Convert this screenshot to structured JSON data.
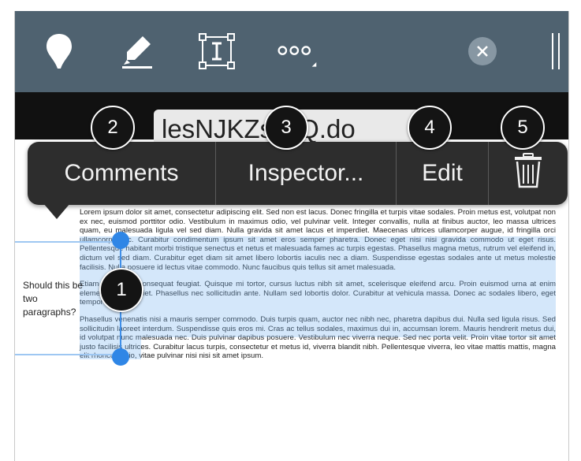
{
  "toolbar": {
    "icons": [
      "pin-icon",
      "highlighter-icon",
      "text-box-icon",
      "more-icon",
      "close-icon",
      "sidebar-handle-icon"
    ]
  },
  "document": {
    "filename_tab": "lesNJKZstNQ.do",
    "paragraphs": [
      "Lorem ipsum dolor sit amet, consectetur adipiscing elit. Sed non est lacus. Donec fringilla et turpis vitae sodales. Proin metus est, volutpat non ex nec, euismod porttitor odio. Vestibulum in maximus odio, vel pulvinar velit. Integer convallis, nulla at finibus auctor, leo massa ultrices quam, eu malesuada ligula vel sed diam. Nulla gravida sit amet lacus et imperdiet. Maecenas ultrices ullamcorper augue, id fringilla orci ullamcorper ac. Curabitur condimentum ipsum sit amet eros semper pharetra. Donec eget nisi nisi gravida commodo ut eget risus. Pellentesque habitant morbi tristique senectus et netus et malesuada fames ac turpis egestas. Phasellus magna metus, rutrum vel eleifend in, dictum vel sed diam. Curabitur eget diam sit amet libero lobortis iaculis nec a diam. Suspendisse egestas sodales ante ut metus molestie facilisis. Nulla posuere id lectus vitae commodo. Nunc faucibus quis tellus sit amet malesuada.",
      "Etiam bibendum consequat feugiat. Quisque mi tortor, cursus luctus nibh sit amet, scelerisque eleifend arcu. Proin euismod urna at enim elementum imperdiet. Phasellus nec sollicitudin ante. Nullam sed lobortis dolor. Curabitur at vehicula massa. Donec ac sodales libero, eget tempor sem.",
      "Phasellus venenatis nisi a mauris semper commodo. Duis turpis quam, auctor nec nibh nec, pharetra dapibus dui. Nulla sed ligula risus. Sed sollicitudin laoreet interdum. Suspendisse quis eros mi. Cras ac tellus sodales, maximus dui in, accumsan lorem. Mauris hendrerit metus dui, id volutpat nunc malesuada nec. Duis pulvinar dapibus posuere. Vestibulum nec viverra neque. Sed nec porta velit. Proin vitae tortor sit amet justo facilisis ultrices. Curabitur lacus turpis, consectetur et metus id, viverra blandit nibh. Pellentesque viverra, leo vitae mattis mattis, magna elit rhoncus odio, vitae pulvinar nisi nisi sit amet ipsum."
    ],
    "comment_note": "Should this be two paragraphs?"
  },
  "context_menu": {
    "comments_label": "Comments",
    "inspector_label": "Inspector...",
    "edit_label": "Edit",
    "delete_icon": "trash-icon"
  },
  "callouts": [
    "1",
    "2",
    "3",
    "4",
    "5"
  ],
  "colors": {
    "toolbar_bg": "#4f6270",
    "menu_bg": "#2d2d2d",
    "selection_handle": "#2f86e6"
  }
}
